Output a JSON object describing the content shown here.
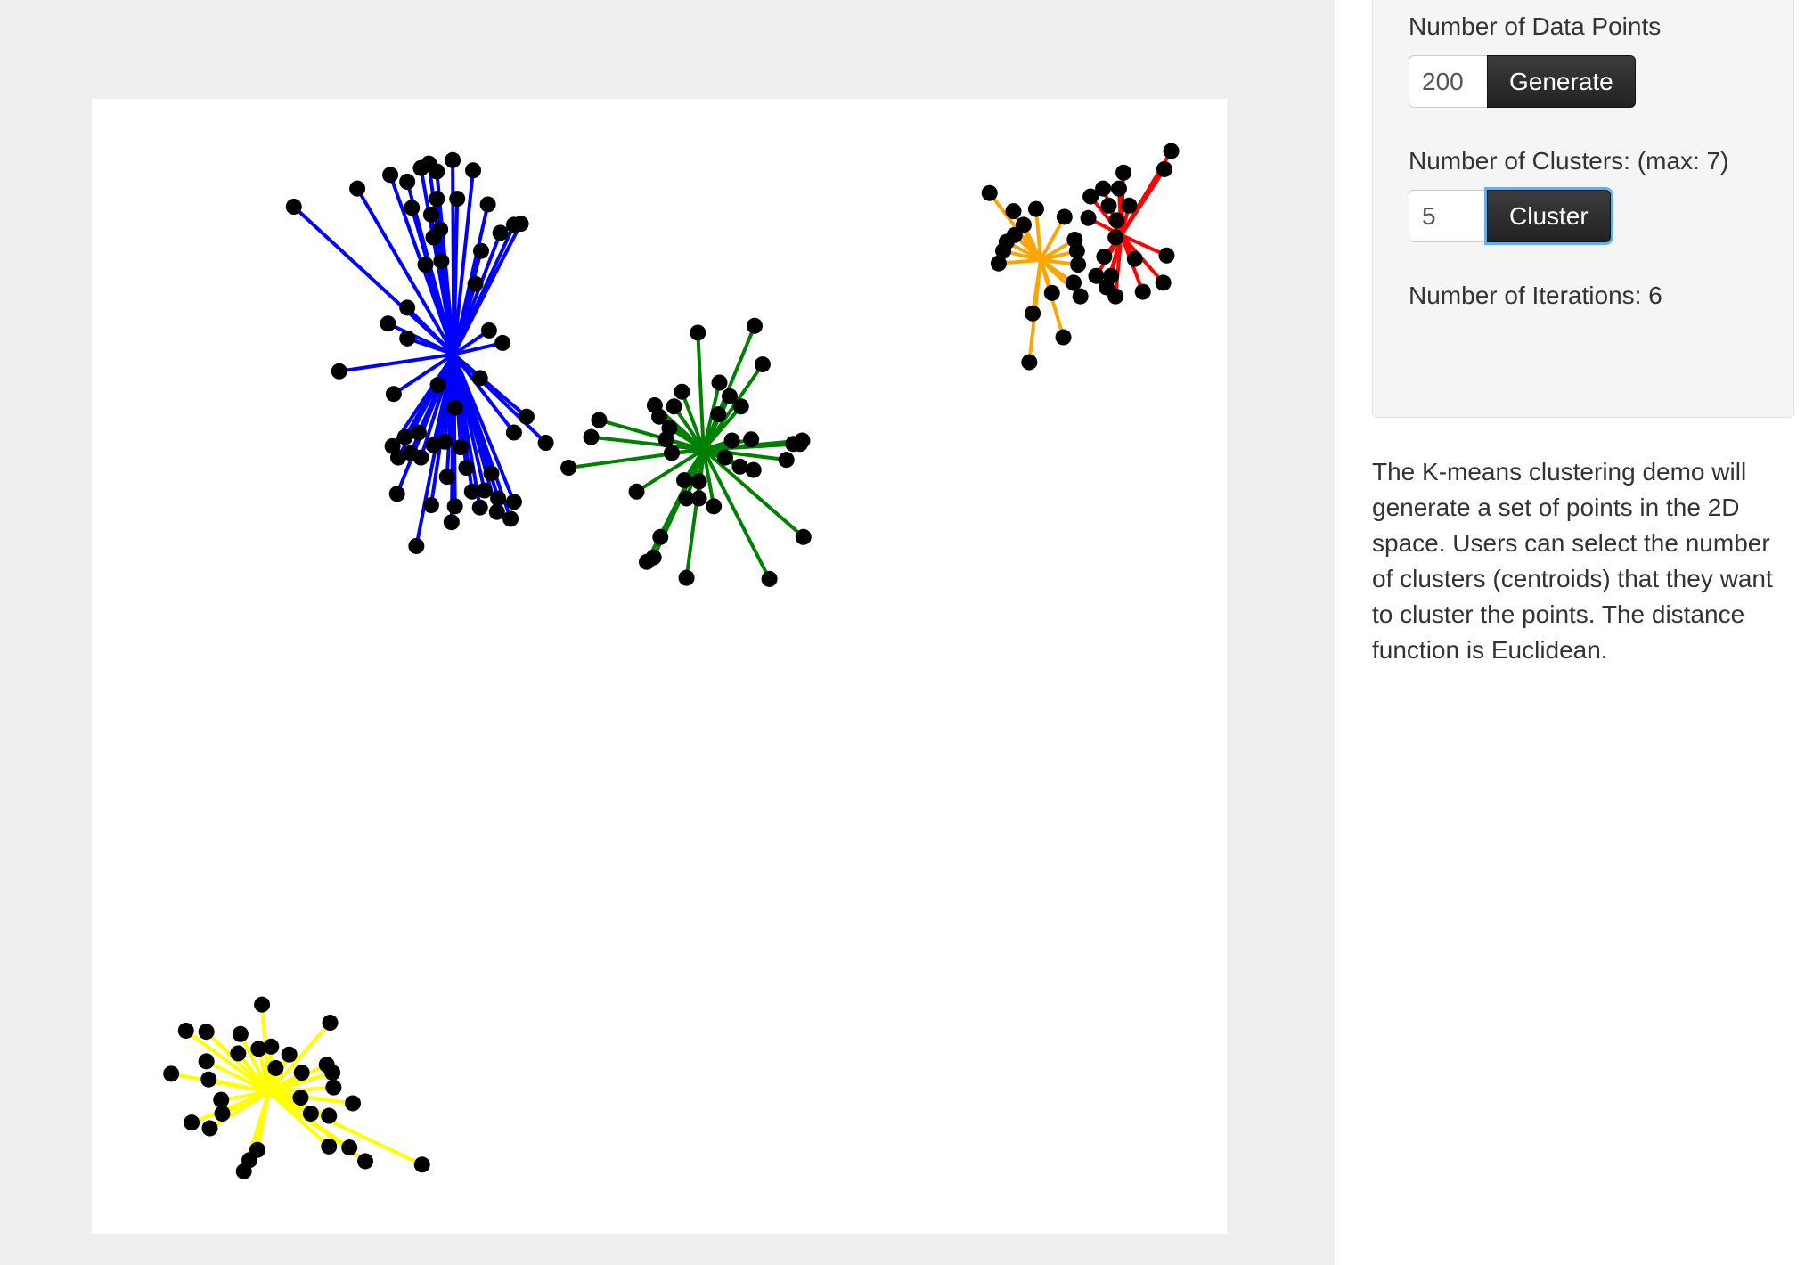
{
  "controls": {
    "points_label": "Number of Data Points",
    "points_value": "200",
    "generate_label": "Generate",
    "clusters_label": "Number of Clusters: (max: 7)",
    "clusters_value": "5",
    "cluster_label": "Cluster",
    "iterations_label": "Number of Iterations: 6"
  },
  "description": "The K-means clustering demo will generate a set of points in the 2D space. Users can select the number of clusters (centroids) that they want to cluster the points. The distance function is Euclidean.",
  "colors": {
    "page_background": "#eeeeee",
    "canvas_background": "#ffffff",
    "point": "#000000",
    "button": "#222222",
    "focus_ring": "#66afe9"
  },
  "chart_data": {
    "type": "scatter",
    "point_color": "#000000",
    "xlim": [
      0,
      1
    ],
    "ylim": [
      0,
      1
    ],
    "clusters": [
      {
        "color": "#0000ff",
        "centroid": [
          0.319,
          0.775
        ],
        "points": [
          [
            0.178,
            0.905
          ],
          [
            0.234,
            0.921
          ],
          [
            0.263,
            0.933
          ],
          [
            0.278,
            0.927
          ],
          [
            0.29,
            0.939
          ],
          [
            0.297,
            0.943
          ],
          [
            0.304,
            0.936
          ],
          [
            0.318,
            0.946
          ],
          [
            0.336,
            0.937
          ],
          [
            0.349,
            0.907
          ],
          [
            0.322,
            0.912
          ],
          [
            0.304,
            0.912
          ],
          [
            0.282,
            0.904
          ],
          [
            0.299,
            0.898
          ],
          [
            0.307,
            0.885
          ],
          [
            0.301,
            0.878
          ],
          [
            0.372,
            0.889
          ],
          [
            0.378,
            0.89
          ],
          [
            0.36,
            0.882
          ],
          [
            0.343,
            0.866
          ],
          [
            0.308,
            0.857
          ],
          [
            0.294,
            0.854
          ],
          [
            0.338,
            0.837
          ],
          [
            0.278,
            0.816
          ],
          [
            0.261,
            0.802
          ],
          [
            0.35,
            0.796
          ],
          [
            0.278,
            0.789
          ],
          [
            0.362,
            0.785
          ],
          [
            0.218,
            0.76
          ],
          [
            0.266,
            0.74
          ],
          [
            0.305,
            0.748
          ],
          [
            0.32,
            0.728
          ],
          [
            0.342,
            0.754
          ],
          [
            0.383,
            0.72
          ],
          [
            0.372,
            0.706
          ],
          [
            0.301,
            0.695
          ],
          [
            0.288,
            0.706
          ],
          [
            0.276,
            0.702
          ],
          [
            0.265,
            0.694
          ],
          [
            0.27,
            0.684
          ],
          [
            0.29,
            0.684
          ],
          [
            0.281,
            0.688
          ],
          [
            0.311,
            0.698
          ],
          [
            0.325,
            0.693
          ],
          [
            0.33,
            0.675
          ],
          [
            0.352,
            0.67
          ],
          [
            0.369,
            0.63
          ],
          [
            0.342,
            0.64
          ],
          [
            0.32,
            0.641
          ],
          [
            0.299,
            0.642
          ],
          [
            0.269,
            0.652
          ],
          [
            0.372,
            0.645
          ],
          [
            0.358,
            0.648
          ],
          [
            0.346,
            0.655
          ],
          [
            0.4,
            0.697
          ],
          [
            0.317,
            0.627
          ],
          [
            0.357,
            0.636
          ],
          [
            0.286,
            0.606
          ],
          [
            0.335,
            0.654
          ],
          [
            0.313,
            0.667
          ]
        ]
      },
      {
        "color": "#008000",
        "centroid": [
          0.539,
          0.691
        ],
        "points": [
          [
            0.534,
            0.794
          ],
          [
            0.584,
            0.8
          ],
          [
            0.591,
            0.766
          ],
          [
            0.553,
            0.75
          ],
          [
            0.552,
            0.722
          ],
          [
            0.562,
            0.738
          ],
          [
            0.572,
            0.729
          ],
          [
            0.52,
            0.742
          ],
          [
            0.496,
            0.73
          ],
          [
            0.5,
            0.72
          ],
          [
            0.513,
            0.729
          ],
          [
            0.447,
            0.717
          ],
          [
            0.44,
            0.702
          ],
          [
            0.509,
            0.71
          ],
          [
            0.506,
            0.7
          ],
          [
            0.511,
            0.688
          ],
          [
            0.42,
            0.675
          ],
          [
            0.564,
            0.699
          ],
          [
            0.558,
            0.684
          ],
          [
            0.581,
            0.7
          ],
          [
            0.583,
            0.673
          ],
          [
            0.612,
            0.682
          ],
          [
            0.624,
            0.696
          ],
          [
            0.626,
            0.699
          ],
          [
            0.618,
            0.696
          ],
          [
            0.571,
            0.676
          ],
          [
            0.535,
            0.663
          ],
          [
            0.522,
            0.664
          ],
          [
            0.524,
            0.648
          ],
          [
            0.548,
            0.641
          ],
          [
            0.48,
            0.654
          ],
          [
            0.535,
            0.648
          ],
          [
            0.627,
            0.614
          ],
          [
            0.501,
            0.614
          ],
          [
            0.495,
            0.596
          ],
          [
            0.489,
            0.592
          ],
          [
            0.524,
            0.578
          ],
          [
            0.597,
            0.577
          ]
        ]
      },
      {
        "color": "#ffa500",
        "centroid": [
          0.836,
          0.858
        ],
        "points": [
          [
            0.791,
            0.917
          ],
          [
            0.812,
            0.901
          ],
          [
            0.832,
            0.903
          ],
          [
            0.857,
            0.896
          ],
          [
            0.866,
            0.876
          ],
          [
            0.868,
            0.866
          ],
          [
            0.869,
            0.854
          ],
          [
            0.865,
            0.838
          ],
          [
            0.871,
            0.826
          ],
          [
            0.846,
            0.829
          ],
          [
            0.806,
            0.874
          ],
          [
            0.799,
            0.855
          ],
          [
            0.821,
            0.889
          ],
          [
            0.829,
            0.811
          ],
          [
            0.856,
            0.79
          ],
          [
            0.826,
            0.768
          ],
          [
            0.803,
            0.866
          ],
          [
            0.813,
            0.88
          ]
        ]
      },
      {
        "color": "#ff0000",
        "centroid": [
          0.907,
          0.88
        ],
        "points": [
          [
            0.951,
            0.954
          ],
          [
            0.945,
            0.938
          ],
          [
            0.909,
            0.935
          ],
          [
            0.891,
            0.921
          ],
          [
            0.88,
            0.914
          ],
          [
            0.878,
            0.895
          ],
          [
            0.896,
            0.906
          ],
          [
            0.902,
            0.878
          ],
          [
            0.892,
            0.861
          ],
          [
            0.885,
            0.844
          ],
          [
            0.898,
            0.844
          ],
          [
            0.902,
            0.826
          ],
          [
            0.926,
            0.83
          ],
          [
            0.944,
            0.838
          ],
          [
            0.947,
            0.862
          ],
          [
            0.914,
            0.906
          ],
          [
            0.905,
            0.921
          ],
          [
            0.903,
            0.893
          ],
          [
            0.894,
            0.834
          ],
          [
            0.919,
            0.859
          ]
        ]
      },
      {
        "color": "#ffff00",
        "centroid": [
          0.156,
          0.125
        ],
        "points": [
          [
            0.15,
            0.202
          ],
          [
            0.21,
            0.186
          ],
          [
            0.083,
            0.179
          ],
          [
            0.101,
            0.178
          ],
          [
            0.131,
            0.176
          ],
          [
            0.147,
            0.163
          ],
          [
            0.158,
            0.165
          ],
          [
            0.174,
            0.158
          ],
          [
            0.185,
            0.142
          ],
          [
            0.207,
            0.149
          ],
          [
            0.129,
            0.159
          ],
          [
            0.101,
            0.152
          ],
          [
            0.07,
            0.141
          ],
          [
            0.103,
            0.136
          ],
          [
            0.212,
            0.142
          ],
          [
            0.213,
            0.129
          ],
          [
            0.23,
            0.115
          ],
          [
            0.209,
            0.104
          ],
          [
            0.193,
            0.106
          ],
          [
            0.115,
            0.106
          ],
          [
            0.088,
            0.098
          ],
          [
            0.104,
            0.093
          ],
          [
            0.209,
            0.077
          ],
          [
            0.227,
            0.076
          ],
          [
            0.241,
            0.064
          ],
          [
            0.291,
            0.061
          ],
          [
            0.146,
            0.074
          ],
          [
            0.134,
            0.055
          ],
          [
            0.139,
            0.065
          ],
          [
            0.184,
            0.12
          ],
          [
            0.162,
            0.146
          ],
          [
            0.114,
            0.118
          ]
        ]
      }
    ]
  }
}
